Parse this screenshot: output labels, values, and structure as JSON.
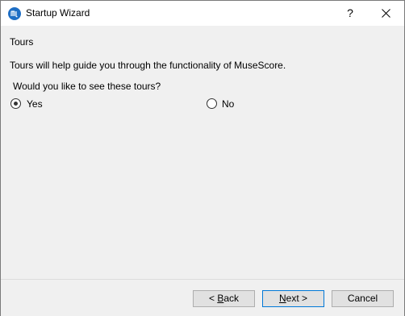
{
  "window": {
    "title": "Startup Wizard",
    "help_label": "?",
    "icon": "musescore-logo-icon",
    "close_icon": "close-icon"
  },
  "page": {
    "title": "Tours",
    "description": "Tours will help guide you through the functionality of MuseScore.",
    "question": "Would you like to see these tours?"
  },
  "options": [
    {
      "label": "Yes",
      "selected": true
    },
    {
      "label": "No",
      "selected": false
    }
  ],
  "buttons": {
    "back": {
      "mnemonic": "B",
      "rest": "ack"
    },
    "next": {
      "mnemonic": "N",
      "rest": "ext >"
    },
    "cancel": "Cancel"
  },
  "colors": {
    "accent": "#0078d7",
    "icon_blue": "#1f6fc5",
    "window_bg": "#f0f0f0"
  }
}
